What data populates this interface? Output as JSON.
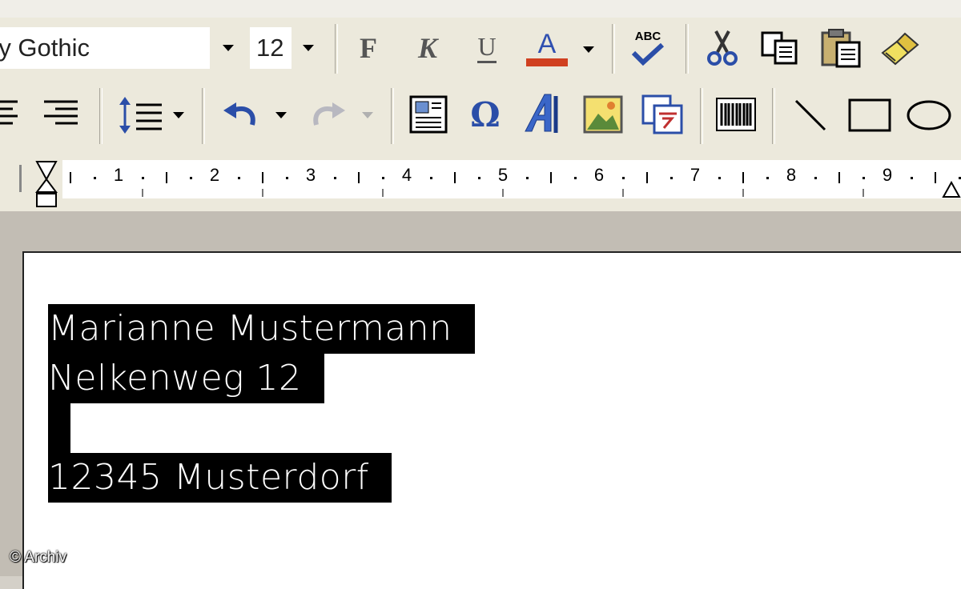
{
  "toolbar": {
    "font_name": "ry Gothic",
    "font_size": "12",
    "bold_label": "F",
    "italic_label": "K",
    "underline_label": "U",
    "font_color_label": "A",
    "font_color": "#d04020",
    "spellcheck_label": "ABC",
    "special_char_label": "Ω"
  },
  "ruler": {
    "numbers": [
      "1",
      "2",
      "3",
      "4",
      "5",
      "6",
      "7",
      "8",
      "9"
    ]
  },
  "document": {
    "lines": [
      "Marianne Mustermann",
      "Nelkenweg 12",
      "",
      "12345 Musterdorf"
    ]
  },
  "credit": "© Archiv"
}
